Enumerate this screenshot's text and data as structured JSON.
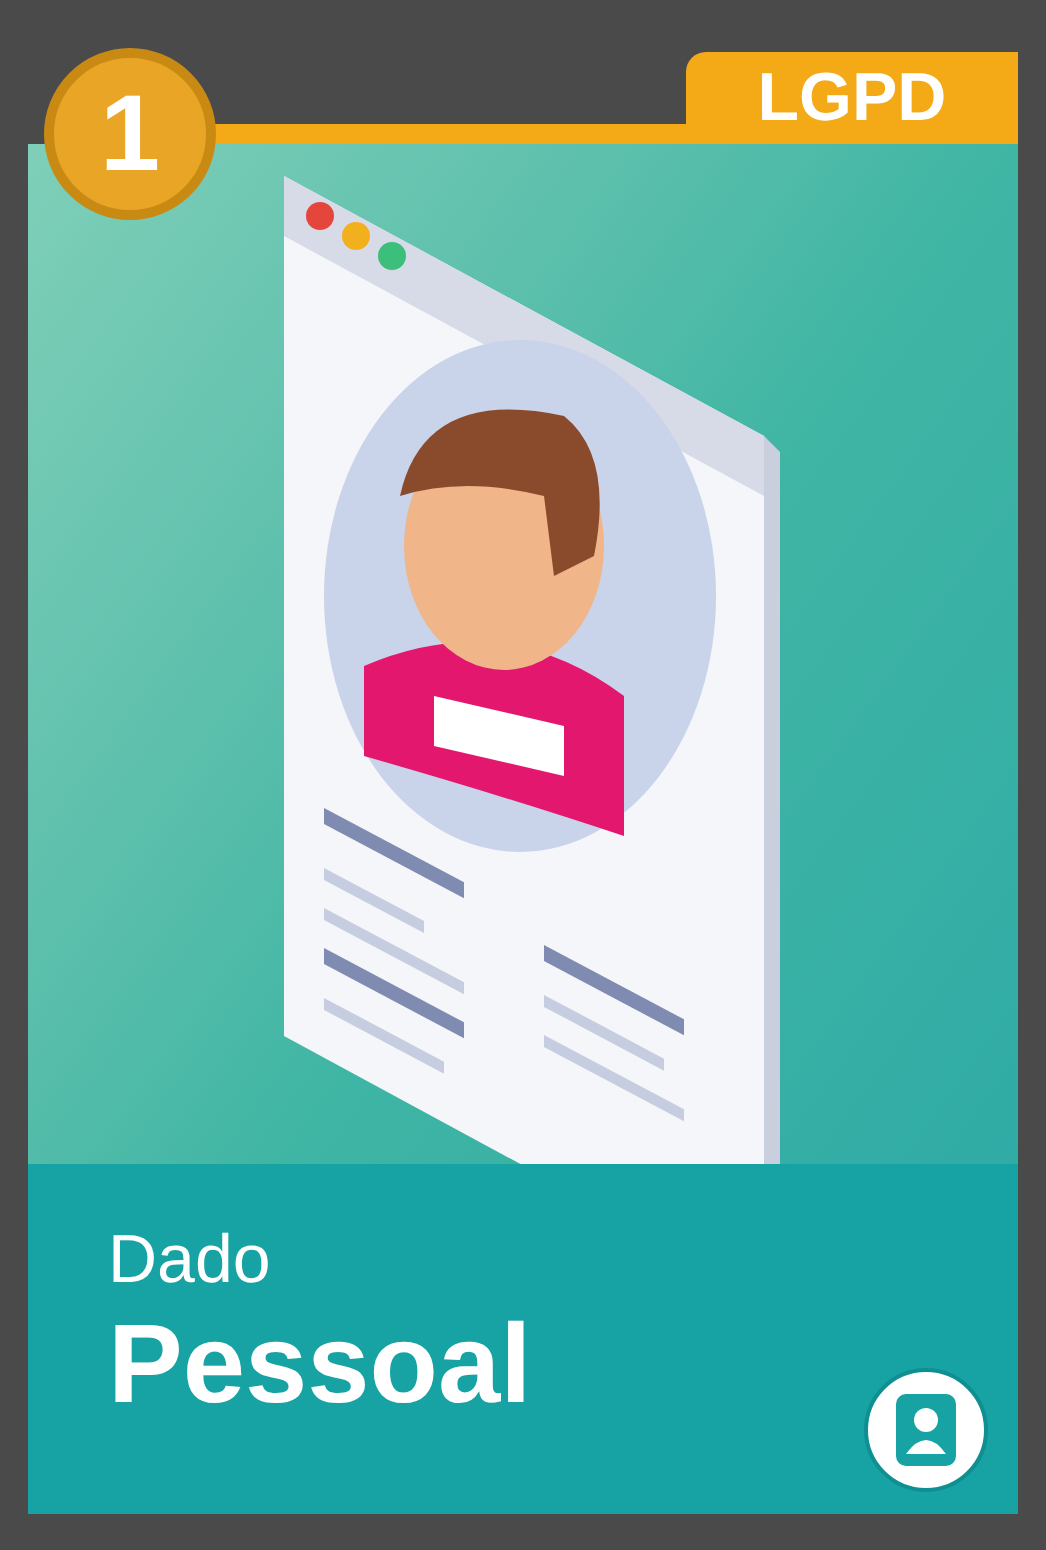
{
  "badge": {
    "number": "1"
  },
  "tag": {
    "label": "LGPD"
  },
  "title": {
    "subtitle": "Dado",
    "main": "Pessoal"
  }
}
